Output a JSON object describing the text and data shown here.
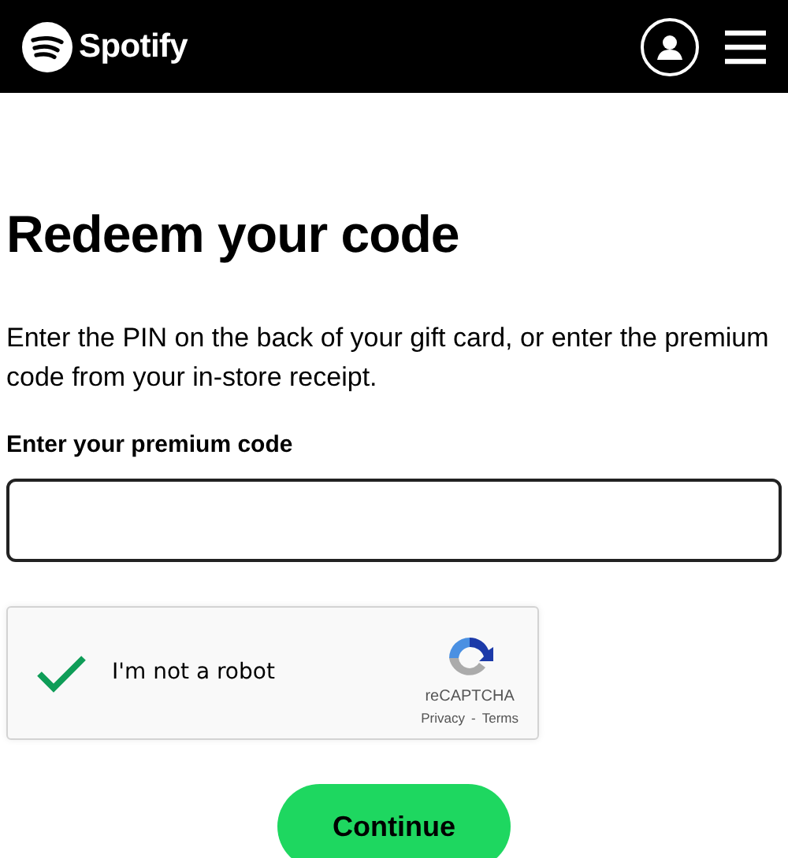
{
  "header": {
    "brand": "Spotify"
  },
  "title": "Redeem your code",
  "description": "Enter the PIN on the back of your gift card, or enter the premium code from your in-store receipt.",
  "code_field": {
    "label": "Enter your premium code"
  },
  "captcha": {
    "label": "I'm not a robot",
    "checked": true,
    "brand": "reCAPTCHA",
    "privacy": "Privacy",
    "separator": "-",
    "terms": "Terms"
  },
  "button": "Continue"
}
